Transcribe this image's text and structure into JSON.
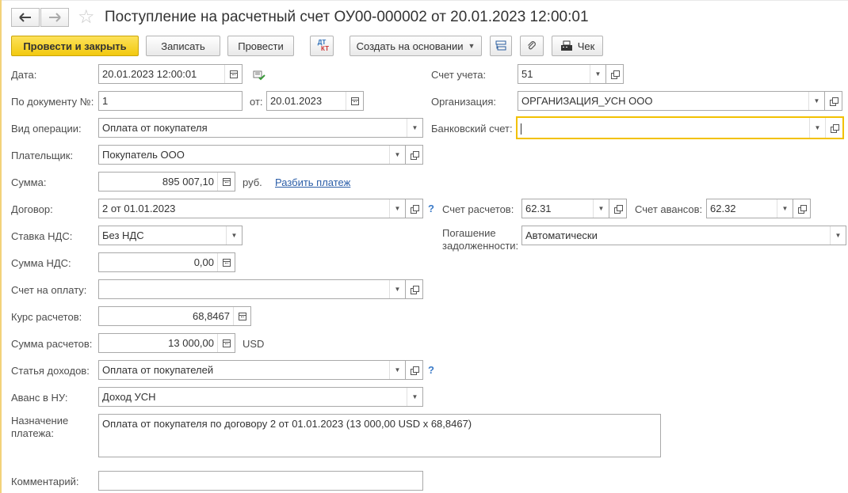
{
  "window": {
    "title": "Поступление на расчетный счет ОУ00-000002 от 20.01.2023 12:00:01"
  },
  "toolbar": {
    "post_and_close": "Провести и закрыть",
    "save": "Записать",
    "post": "Провести",
    "dtkt_top": "ДТ",
    "dtkt_bottom": "КТ",
    "create_based_on": "Создать на основании",
    "receipt": "Чек"
  },
  "form": {
    "date": {
      "label": "Дата:",
      "value": "20.01.2023 12:00:01"
    },
    "account": {
      "label": "Счет учета:",
      "value": "51"
    },
    "doc_number": {
      "label": "По документу №:",
      "value": "1"
    },
    "doc_date": {
      "label": "от:",
      "value": "20.01.2023"
    },
    "organization": {
      "label": "Организация:",
      "value": "ОРГАНИЗАЦИЯ_УСН ООО"
    },
    "operation_type": {
      "label": "Вид операции:",
      "value": "Оплата от покупателя"
    },
    "bank_account": {
      "label": "Банковский счет:",
      "value": ""
    },
    "payer": {
      "label": "Плательщик:",
      "value": "Покупатель ООО"
    },
    "amount": {
      "label": "Сумма:",
      "value": "895 007,10",
      "unit": "руб.",
      "split_link": "Разбить платеж"
    },
    "contract": {
      "label": "Договор:",
      "value": "2 от 01.01.2023"
    },
    "settlement_account": {
      "label": "Счет расчетов:",
      "value": "62.31"
    },
    "advance_account": {
      "label": "Счет авансов:",
      "value": "62.32"
    },
    "vat_rate": {
      "label": "Ставка НДС:",
      "value": "Без НДС"
    },
    "debt_repayment": {
      "label": "Погашение задолженности:",
      "value": "Автоматически"
    },
    "vat_amount": {
      "label": "Сумма НДС:",
      "value": "0,00"
    },
    "invoice": {
      "label": "Счет на оплату:",
      "value": ""
    },
    "exchange_rate": {
      "label": "Курс расчетов:",
      "value": "68,8467"
    },
    "settlement_amount": {
      "label": "Сумма расчетов:",
      "value": "13 000,00",
      "currency": "USD"
    },
    "income_item": {
      "label": "Статья доходов:",
      "value": "Оплата от покупателей"
    },
    "advance_tax": {
      "label": "Аванс в НУ:",
      "value": "Доход УСН"
    },
    "purpose": {
      "label": "Назначение платежа:",
      "value": "Оплата от покупателя по договору 2 от 01.01.2023 (13 000,00 USD x 68,8467)"
    },
    "comment": {
      "label": "Комментарий:",
      "value": ""
    }
  },
  "icons": {
    "back": "arrow-left-icon",
    "forward": "arrow-right-icon",
    "favorite": "star-icon",
    "structure": "structure-icon",
    "attach": "paperclip-icon",
    "receipt": "cash-register-icon",
    "calendar": "calendar-icon",
    "calculator": "calculator-icon",
    "open": "open-form-icon",
    "help": "question-icon"
  },
  "colors": {
    "primary_button": "#f2c90f",
    "focus_border": "#f2c100",
    "link": "#2b5ea8"
  }
}
